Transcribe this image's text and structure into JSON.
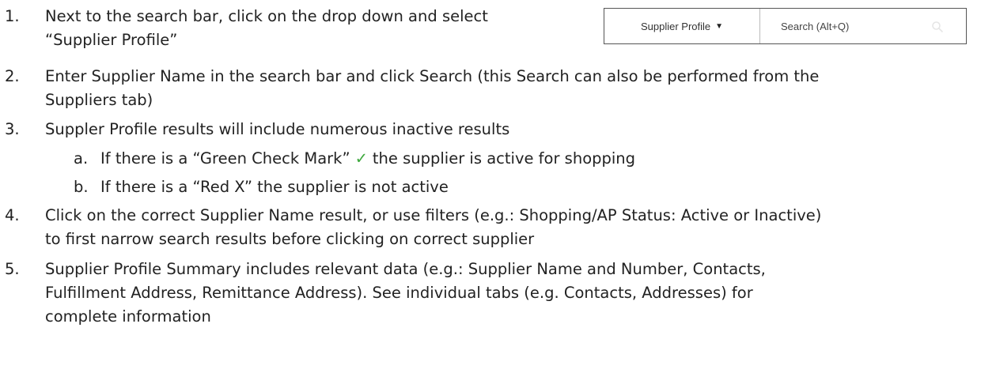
{
  "search_widget": {
    "dropdown_value": "Supplier Profile",
    "search_placeholder": "Search (Alt+Q)",
    "caret_icon": "caret-down-icon",
    "search_icon": "search-icon"
  },
  "steps": [
    {
      "number": "1.",
      "lines": [
        "Next to the search bar, click on the drop down and select",
        "“Supplier Profile”"
      ]
    },
    {
      "number": "2.",
      "lines": [
        "Enter Supplier Name in the search bar and click Search (this Search can also be performed from the",
        "Suppliers tab)"
      ]
    },
    {
      "number": "3.",
      "lines": [
        "Suppler Profile results will include numerous inactive results"
      ],
      "sub_items": [
        {
          "label": "a.",
          "text_before": "If there is a “Green Check Mark”",
          "icon": "check-mark-icon",
          "text_after": "the supplier is active for shopping"
        },
        {
          "label": "b.",
          "text": "If there is a “Red X” the supplier is not active"
        }
      ]
    },
    {
      "number": "4.",
      "lines": [
        "Click on the correct Supplier Name result, or use filters (e.g.: Shopping/AP Status: Active or Inactive)",
        "to first narrow search results before clicking on correct supplier"
      ]
    },
    {
      "number": "5.",
      "lines": [
        "Supplier Profile Summary includes relevant data (e.g.: Supplier Name and Number, Contacts,",
        "Fulfillment Address, Remittance Address). See individual tabs (e.g. Contacts, Addresses) for",
        "complete information"
      ]
    }
  ],
  "colors": {
    "check_mark": "#3ea83e",
    "text": "#222222"
  }
}
